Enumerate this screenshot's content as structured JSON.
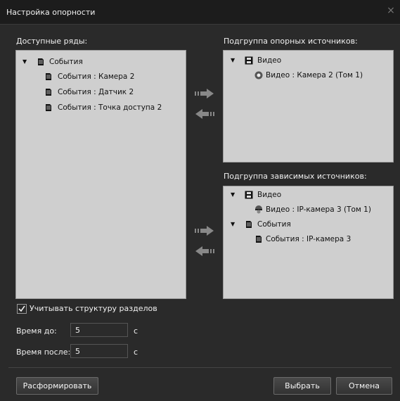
{
  "window": {
    "title": "Настройка опорности",
    "close_icon": "×"
  },
  "available": {
    "label": "Доступные ряды:",
    "tree": [
      {
        "label": "События",
        "icon": "events-icon",
        "expanded": true
      },
      {
        "label": "События : Камера 2",
        "icon": "events-icon"
      },
      {
        "label": "События : Датчик 2",
        "icon": "events-icon"
      },
      {
        "label": "События : Точка доступа 2",
        "icon": "events-icon"
      }
    ]
  },
  "reference": {
    "label": "Подгруппа опорных источников:",
    "tree": [
      {
        "label": "Видео",
        "icon": "film-icon",
        "expanded": true
      },
      {
        "label": "Видео : Камера 2 (Том 1)",
        "icon": "camera-icon"
      }
    ]
  },
  "dependent": {
    "label": "Подгруппа зависимых источников:",
    "tree": [
      {
        "label": "Видео",
        "icon": "film-icon",
        "expanded": true
      },
      {
        "label": "Видео : IP-камера 3 (Том 1)",
        "icon": "dome-camera-icon"
      },
      {
        "label": "События",
        "icon": "events-icon",
        "expanded": true
      },
      {
        "label": "События : IP-камера 3",
        "icon": "events-icon"
      }
    ]
  },
  "options": {
    "structure_checkbox_label": "Учитывать структуру разделов",
    "structure_checked": true,
    "time_before_label": "Время до:",
    "time_before_value": "5",
    "time_after_label": "Время после:",
    "time_after_value": "5",
    "unit": "с"
  },
  "buttons": {
    "disband": "Расформировать",
    "select": "Выбрать",
    "cancel": "Отмена"
  },
  "colors": {
    "window_bg": "#2a2a2a",
    "panel_bg": "#cfcfcf",
    "titlebar_bg": "#1c1c1c"
  }
}
